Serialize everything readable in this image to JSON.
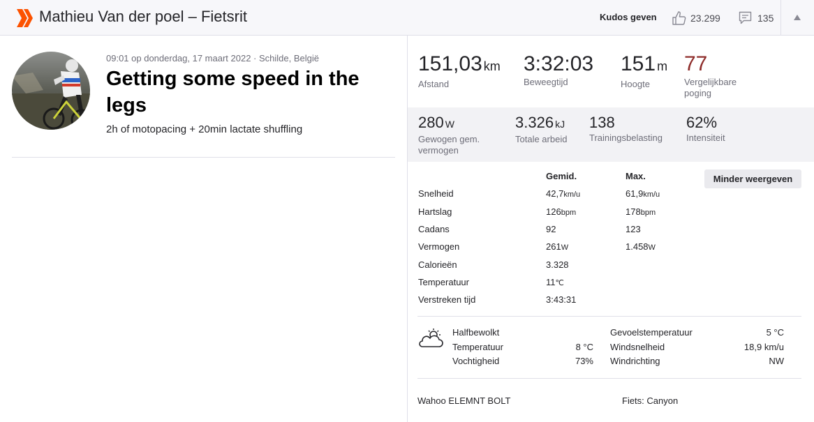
{
  "header": {
    "title": "Mathieu Van der poel – Fietsrit",
    "kudos_label": "Kudos geven",
    "kudos_count": "23.299",
    "comment_count": "135",
    "brand_color": "#fc5200"
  },
  "activity": {
    "meta": "09:01 op donderdag, 17 maart 2022 · Schilde, België",
    "title": "Getting some speed in the legs",
    "description": "2h of motopacing + 20min lactate shuffling"
  },
  "primary_stats": [
    {
      "value": "151,03",
      "unit": "km",
      "label": "Afstand"
    },
    {
      "value": "3:32:03",
      "unit": "",
      "label": "Beweegtijd"
    },
    {
      "value": "151",
      "unit": "m",
      "label": "Hoogte"
    },
    {
      "value": "77",
      "unit": "",
      "label": "Vergelijkbare poging"
    }
  ],
  "secondary_stats": [
    {
      "value": "280",
      "unit": "W",
      "label": "Gewogen gem. vermogen"
    },
    {
      "value": "3.326",
      "unit": "kJ",
      "label": "Totale arbeid"
    },
    {
      "value": "138",
      "unit": "",
      "label": "Trainingsbelasting"
    },
    {
      "value": "62%",
      "unit": "",
      "label": "Intensiteit"
    }
  ],
  "details": {
    "col_avg": "Gemid.",
    "col_max": "Max.",
    "toggle_label": "Minder weergeven",
    "rows": [
      {
        "label": "Snelheid",
        "avg": "42,7",
        "avg_unit": "km/u",
        "max": "61,9",
        "max_unit": "km/u"
      },
      {
        "label": "Hartslag",
        "avg": "126",
        "avg_unit": "bpm",
        "max": "178",
        "max_unit": "bpm"
      },
      {
        "label": "Cadans",
        "avg": "92",
        "avg_unit": "",
        "max": "123",
        "max_unit": ""
      },
      {
        "label": "Vermogen",
        "avg": "261",
        "avg_unit": "W",
        "max": "1.458",
        "max_unit": "W"
      },
      {
        "label": "Calorieën",
        "avg": "3.328",
        "avg_unit": "",
        "max": "",
        "max_unit": ""
      },
      {
        "label": "Temperatuur",
        "avg": "11",
        "avg_unit": "℃",
        "max": "",
        "max_unit": ""
      },
      {
        "label": "Verstreken tijd",
        "avg": "3:43:31",
        "avg_unit": "",
        "max": "",
        "max_unit": ""
      }
    ]
  },
  "weather": {
    "icon": "partly-cloudy-icon",
    "condition": "Halfbewolkt",
    "temp_label": "Temperatuur",
    "temp_value": "8 °C",
    "humidity_label": "Vochtigheid",
    "humidity_value": "73%",
    "feels_label": "Gevoelstemperatuur",
    "feels_value": "5 °C",
    "wind_speed_label": "Windsnelheid",
    "wind_speed_value": "18,9 km/u",
    "wind_dir_label": "Windrichting",
    "wind_dir_value": "NW"
  },
  "gear": {
    "device": "Wahoo ELEMNT BOLT",
    "bike": "Fiets: Canyon"
  }
}
